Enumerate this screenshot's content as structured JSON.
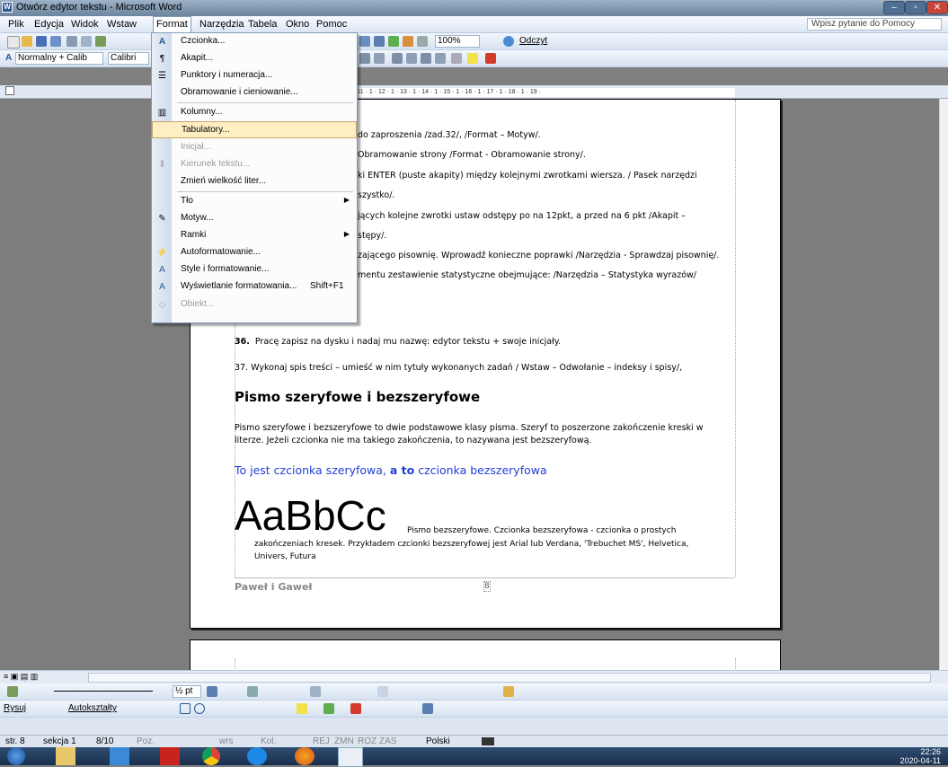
{
  "window": {
    "title": "Otwórz edytor tekstu - Microsoft Word"
  },
  "menubar": {
    "items": [
      "Plik",
      "Edycja",
      "Widok",
      "Wstaw",
      "Format",
      "Narzędzia",
      "Tabela",
      "Okno",
      "Pomoc"
    ],
    "help_placeholder": "Wpisz pytanie do Pomocy"
  },
  "toolbar": {
    "zoom": "100%",
    "read_label": "Odczyt",
    "style": "Normalny + Calib",
    "font": "Calibri"
  },
  "ruler": {
    "marks": "1 · 5 · 1 · 6 · 1 · 7 · 1 · 8 · 1 · 9 · 1 · 10 · 1 · 11 · 1 · 12 · 1 · 13 · 1 · 14 · 1 · 15 · 1 · 16 · 1 · 17 · 1 · 18 · 1 · 19 ·"
  },
  "format_menu": {
    "items": [
      {
        "label": "Czcionka...",
        "icon": "A"
      },
      {
        "label": "Akapit...",
        "icon": "¶"
      },
      {
        "label": "Punktory i numeracja...",
        "icon": "☰"
      },
      {
        "label": "Obramowanie i cieniowanie...",
        "icon": ""
      },
      {
        "label": "Kolumny...",
        "icon": "▥"
      },
      {
        "label": "Tabulatory...",
        "icon": ""
      },
      {
        "label": "Inicjał...",
        "icon": ""
      },
      {
        "label": "Kierunek tekstu...",
        "icon": "⫴"
      },
      {
        "label": "Zmień wielkość liter...",
        "icon": ""
      },
      {
        "label": "Tło",
        "icon": ""
      },
      {
        "label": "Motyw...",
        "icon": "✎"
      },
      {
        "label": "Ramki",
        "icon": ""
      },
      {
        "label": "Autoformatowanie...",
        "icon": "⚡"
      },
      {
        "label": "Style i formatowanie...",
        "icon": "A"
      },
      {
        "label": "Wyświetlanie formatowania...",
        "icon": "A",
        "shortcut": "Shift+F1"
      },
      {
        "label": "Obiekt...",
        "icon": "◇"
      }
    ]
  },
  "document": {
    "lines": [
      "do zaproszenia /zad.32/, /Format – Motyw/.",
      "Obramowanie strony /Format - Obramowanie strony/.",
      "ki ENTER (puste akapity) między kolejnymi zwrotkami wiersza. / Pasek narzędzi",
      "szystko/.",
      "jących kolejne zwrotki ustaw odstępy po na 12pkt, a przed na 6 pkt /Akapit –",
      "stępy/.",
      "zającego pisownię. Wprowadź konieczne poprawki /Narzędzia - Sprawdzaj pisownię/.",
      "mentu zestawienie statystyczne obejmujące: /Narzędzia – Statystyka wyrazów/"
    ],
    "item36_num": "36.",
    "item36": "Pracę zapisz na dysku i nadaj mu nazwę: edytor tekstu + swoje inicjały.",
    "item37": "37. Wykonaj spis treści – umieść w nim tytuły wykonanych zadań / Wstaw – Odwołanie – indeksy i spisy/,",
    "heading": "Pismo szeryfowe i bezszeryfowe",
    "para1": "Pismo szeryfowe i bezszeryfowe to dwie podstawowe klasy pisma. Szeryf to poszerzone zakończenie kreski w",
    "para2": "literze. Jeżeli czcionka nie ma takiego zakończenia, to nazywana jest bezszeryfową.",
    "colored_a": "To jest czcionka szeryfowa,",
    "colored_b": "a to",
    "colored_c": "czcionka bezszeryfowa",
    "big": "AaBbCc",
    "caption1": "Pismo bezszeryfowe. Czcionka bezszeryfowa - czcionka o prostych",
    "caption2": "zakończeniach kresek. Przykładem czcionki bezszeryfowej jest Arial lub Verdana, 'Trebuchet MS', Helvetica,",
    "caption3": "Univers, Futura",
    "footer": "Paweł i Gaweł",
    "page_num": "8"
  },
  "drawing": {
    "draw_label": "Rysuj",
    "autoshapes_label": "Autokształty",
    "line_width": "½ pt"
  },
  "status": {
    "page": "str. 8",
    "section": "sekcja 1",
    "pages": "8/10",
    "pos": "Poz.",
    "line": "wrs",
    "col": "Kol.",
    "rej": "REJ",
    "zmn": "ZMN",
    "roz": "ROZ",
    "zas": "ZAS",
    "language": "Polski"
  },
  "clock": {
    "time": "22:26",
    "date": "2020-04-11"
  },
  "colors": {
    "accent": "#2b5797",
    "highlight": "#ffeec2",
    "blue_text": "#1f3fd6"
  }
}
